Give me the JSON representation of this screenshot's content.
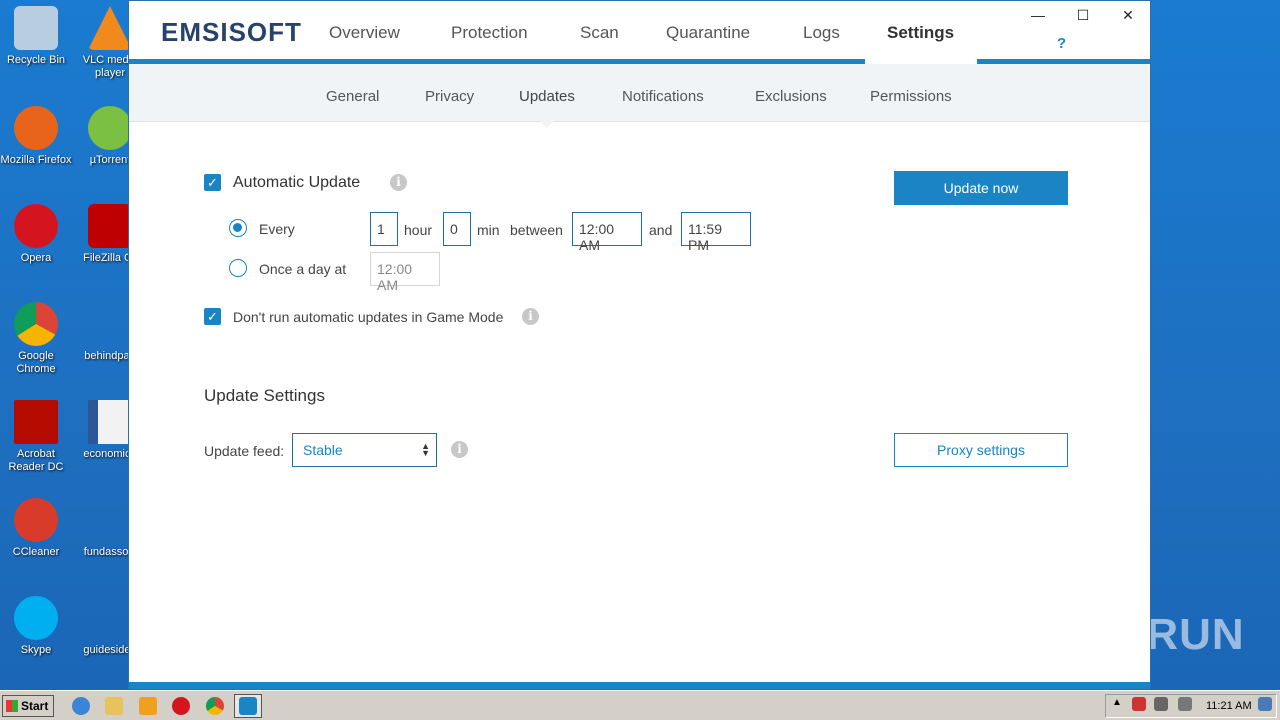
{
  "desktop": {
    "icons": [
      {
        "label": "Recycle Bin",
        "icon": "recycle-bin-icon",
        "color": "#b9cde0"
      },
      {
        "label": "VLC media player",
        "icon": "vlc-icon",
        "color": "#f08a1c"
      },
      {
        "label": "Mozilla Firefox",
        "icon": "firefox-icon",
        "color": "#e8641b"
      },
      {
        "label": "µTorrent",
        "icon": "utorrent-icon",
        "color": "#7bc043"
      },
      {
        "label": "Opera",
        "icon": "opera-icon",
        "color": "#d4151f"
      },
      {
        "label": "FileZilla Cli",
        "icon": "filezilla-icon",
        "color": "#bf0000"
      },
      {
        "label": "Google Chrome",
        "icon": "chrome-icon",
        "color": "#4caf50"
      },
      {
        "label": "behindpau",
        "icon": "file-icon",
        "color": "#1e6fc0"
      },
      {
        "label": "Acrobat Reader DC",
        "icon": "acrobat-icon",
        "color": "#b30b00"
      },
      {
        "label": "economicg",
        "icon": "word-doc-icon",
        "color": "#2b5797"
      },
      {
        "label": "CCleaner",
        "icon": "ccleaner-icon",
        "color": "#d93b2b"
      },
      {
        "label": "fundassoci",
        "icon": "file-icon",
        "color": "#1e6fc0"
      },
      {
        "label": "Skype",
        "icon": "skype-icon",
        "color": "#00aff0"
      },
      {
        "label": "guidesidea",
        "icon": "file-icon",
        "color": "#1e6fc0"
      }
    ]
  },
  "app": {
    "logo": "EMSISOFT",
    "nav": [
      "Overview",
      "Protection",
      "Scan",
      "Quarantine",
      "Logs",
      "Settings"
    ],
    "active_nav": "Settings",
    "help": "?",
    "window_controls": {
      "minimize": "—",
      "maximize": "☐",
      "close": "✕"
    },
    "subnav": [
      "General",
      "Privacy",
      "Updates",
      "Notifications",
      "Exclusions",
      "Permissions"
    ],
    "active_subnav": "Updates",
    "auto_update": {
      "label": "Automatic Update",
      "checked": true,
      "every_label": "Every",
      "every_selected": true,
      "hours": "1",
      "hour_unit": "hour",
      "minutes": "0",
      "min_unit": "min",
      "between_label": "between",
      "from_time": "12:00 AM",
      "and_label": "and",
      "to_time": "11:59 PM",
      "once_label": "Once a day at",
      "once_time": "12:00 AM"
    },
    "game_mode": {
      "label": "Don't run automatic updates in Game Mode",
      "checked": true
    },
    "update_now": "Update now",
    "update_settings": {
      "title": "Update Settings",
      "feed_label": "Update feed:",
      "feed_value": "Stable",
      "proxy_button": "Proxy settings"
    }
  },
  "watermark": "ANY RUN",
  "taskbar": {
    "start": "Start",
    "clock": "11:21 AM"
  },
  "colors": {
    "accent": "#1a84c4",
    "logo": "#27436b"
  }
}
